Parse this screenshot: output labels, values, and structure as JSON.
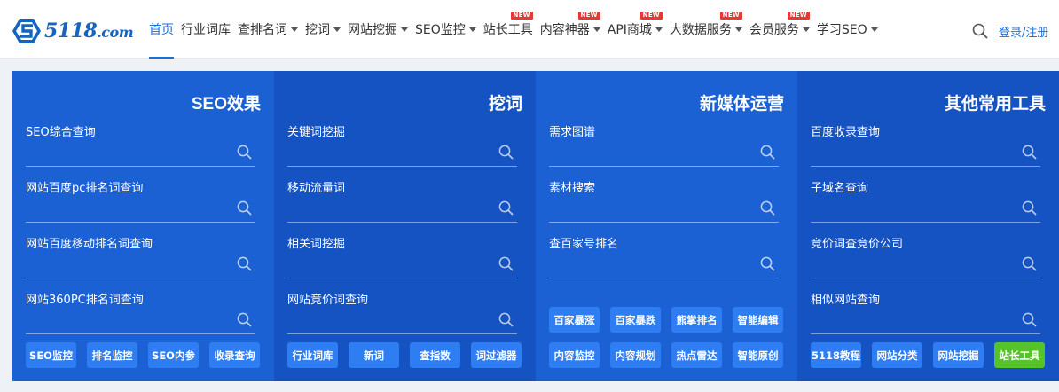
{
  "brand": {
    "name": "5118",
    "suffix": ".com"
  },
  "nav": {
    "items": [
      {
        "label": "首页",
        "active": true,
        "caret": false,
        "badge": ""
      },
      {
        "label": "行业词库",
        "active": false,
        "caret": false,
        "badge": ""
      },
      {
        "label": "查排名词",
        "active": false,
        "caret": true,
        "badge": ""
      },
      {
        "label": "挖词",
        "active": false,
        "caret": true,
        "badge": ""
      },
      {
        "label": "网站挖掘",
        "active": false,
        "caret": true,
        "badge": ""
      },
      {
        "label": "SEO监控",
        "active": false,
        "caret": true,
        "badge": ""
      },
      {
        "label": "站长工具",
        "active": false,
        "caret": false,
        "badge": "NEW"
      },
      {
        "label": "内容神器",
        "active": false,
        "caret": true,
        "badge": "NEW"
      },
      {
        "label": "API商城",
        "active": false,
        "caret": true,
        "badge": "NEW"
      },
      {
        "label": "大数据服务",
        "active": false,
        "caret": true,
        "badge": "NEW"
      },
      {
        "label": "会员服务",
        "active": false,
        "caret": true,
        "badge": "NEW"
      },
      {
        "label": "学习SEO",
        "active": false,
        "caret": true,
        "badge": ""
      }
    ],
    "login": "登录/注册"
  },
  "columns": [
    {
      "title": "SEO效果",
      "fields": [
        "SEO综合查询",
        "网站百度pc排名词查询",
        "网站百度移动排名词查询",
        "网站360PC排名词查询"
      ],
      "buttons": [
        [
          "SEO监控",
          "排名监控",
          "SEO内参",
          "收录查询"
        ]
      ]
    },
    {
      "title": "挖词",
      "fields": [
        "关键词挖掘",
        "移动流量词",
        "相关词挖掘",
        "网站竞价词查询"
      ],
      "buttons": [
        [
          "行业词库",
          "新词",
          "查指数",
          "词过滤器"
        ]
      ]
    },
    {
      "title": "新媒体运营",
      "fields": [
        "需求图谱",
        "素材搜索",
        "查百家号排名"
      ],
      "buttons": [
        [
          "百家暴涨",
          "百家暴跌",
          "熊掌排名",
          "智能编辑"
        ],
        [
          "内容监控",
          "内容规划",
          "热点雷达",
          "智能原创"
        ]
      ]
    },
    {
      "title": "其他常用工具",
      "fields": [
        "百度收录查询",
        "子域名查询",
        "竞价词查竞价公司",
        "相似网站查询"
      ],
      "buttons": [
        [
          "5118教程",
          "网站分类",
          "网站挖掘",
          "站长工具"
        ]
      ],
      "highlight_button": "站长工具"
    }
  ],
  "colors": {
    "accent": "#1a6fd8",
    "panel_a": "#1b61d3",
    "panel_b": "#1552c2",
    "button": "#2f7df2",
    "button_green": "#57c32b",
    "badge": "#e53935"
  }
}
